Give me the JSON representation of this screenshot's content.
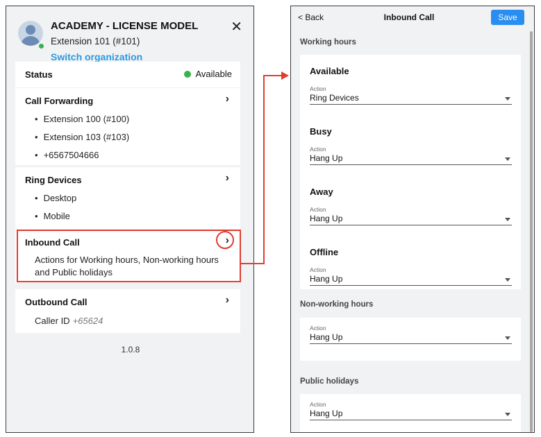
{
  "left_panel": {
    "org_name": "ACADEMY - LICENSE MODEL",
    "extension": "Extension 101 (#101)",
    "switch_org": "Switch organization",
    "close_glyph": "✕",
    "status": {
      "title": "Status",
      "value": "Available",
      "color": "#37b24d"
    },
    "call_forwarding": {
      "title": "Call Forwarding",
      "items": [
        "Extension 100 (#100)",
        "Extension 103 (#103)",
        "+6567504666"
      ]
    },
    "ring_devices": {
      "title": "Ring Devices",
      "items": [
        "Desktop",
        "Mobile"
      ]
    },
    "inbound_call": {
      "title": "Inbound Call",
      "description": "Actions for Working hours, Non-working hours and Public holidays"
    },
    "outbound_call": {
      "title": "Outbound Call",
      "caller_label": "Caller ID",
      "caller_value": "+65624"
    },
    "chevron": "›",
    "version": "1.0.8"
  },
  "right_panel": {
    "back": "< Back",
    "title": "Inbound Call",
    "save": "Save",
    "working_hours_label": "Working hours",
    "working_hours": [
      {
        "status": "Available",
        "action_label": "Action",
        "action": "Ring Devices"
      },
      {
        "status": "Busy",
        "action_label": "Action",
        "action": "Hang Up"
      },
      {
        "status": "Away",
        "action_label": "Action",
        "action": "Hang Up"
      },
      {
        "status": "Offline",
        "action_label": "Action",
        "action": "Hang Up"
      }
    ],
    "non_working_label": "Non-working hours",
    "non_working": {
      "action_label": "Action",
      "action": "Hang Up"
    },
    "public_holidays_label": "Public holidays",
    "public_holidays": {
      "action_label": "Action",
      "action": "Hang Up"
    }
  },
  "colors": {
    "accent": "#2a8df0",
    "link": "#2a9ae0",
    "highlight": "#e03c31",
    "available": "#37b24d"
  }
}
